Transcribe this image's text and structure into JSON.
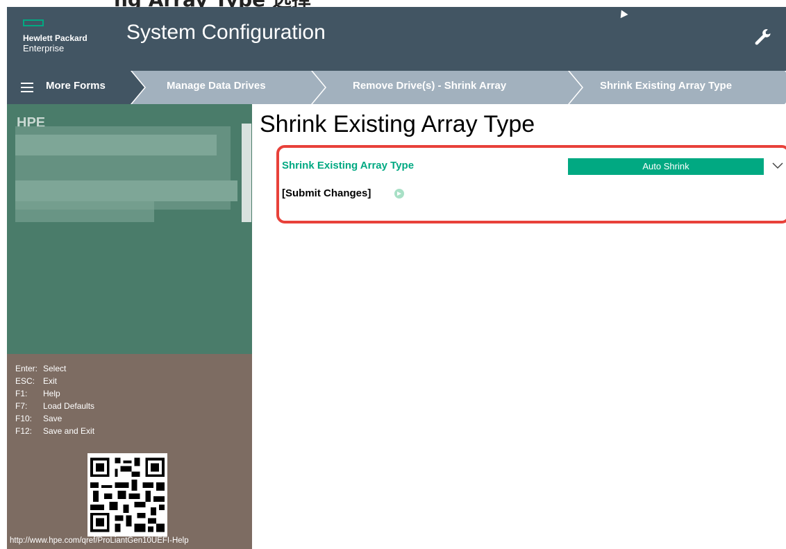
{
  "header": {
    "brand_line1": "Hewlett Packard",
    "brand_line2": "Enterprise",
    "title": "System Configuration",
    "icon": "wrench-icon"
  },
  "breadcrumbs": {
    "menu_label": "More Forms",
    "items": [
      "Manage Data Drives",
      "Remove Drive(s) - Shrink Array",
      "Shrink Existing Array Type"
    ]
  },
  "sidebar": {
    "top_label": "HPE",
    "hotkeys": [
      {
        "key": "Enter:",
        "action": "Select"
      },
      {
        "key": "ESC:",
        "action": "Exit"
      },
      {
        "key": "F1:",
        "action": "Help"
      },
      {
        "key": "F7:",
        "action": "Load Defaults"
      },
      {
        "key": "F10:",
        "action": "Save"
      },
      {
        "key": "F12:",
        "action": "Save and Exit"
      }
    ],
    "help_url": "http://www.hpe.com/qref/ProLiantGen10UEFI-Help"
  },
  "main": {
    "page_title": "Shrink Existing Array Type",
    "field_label": "Shrink Existing Array Type",
    "field_value": "Auto Shrink",
    "submit_label": "[Submit Changes]"
  },
  "colors": {
    "header_bg": "#425563",
    "accent_green": "#01a982",
    "breadcrumb_bg": "#a2b1be",
    "sidebar_top_bg": "#4a7c6a",
    "sidebar_bottom_bg": "#7d6c62",
    "highlight": "#e8413a"
  }
}
